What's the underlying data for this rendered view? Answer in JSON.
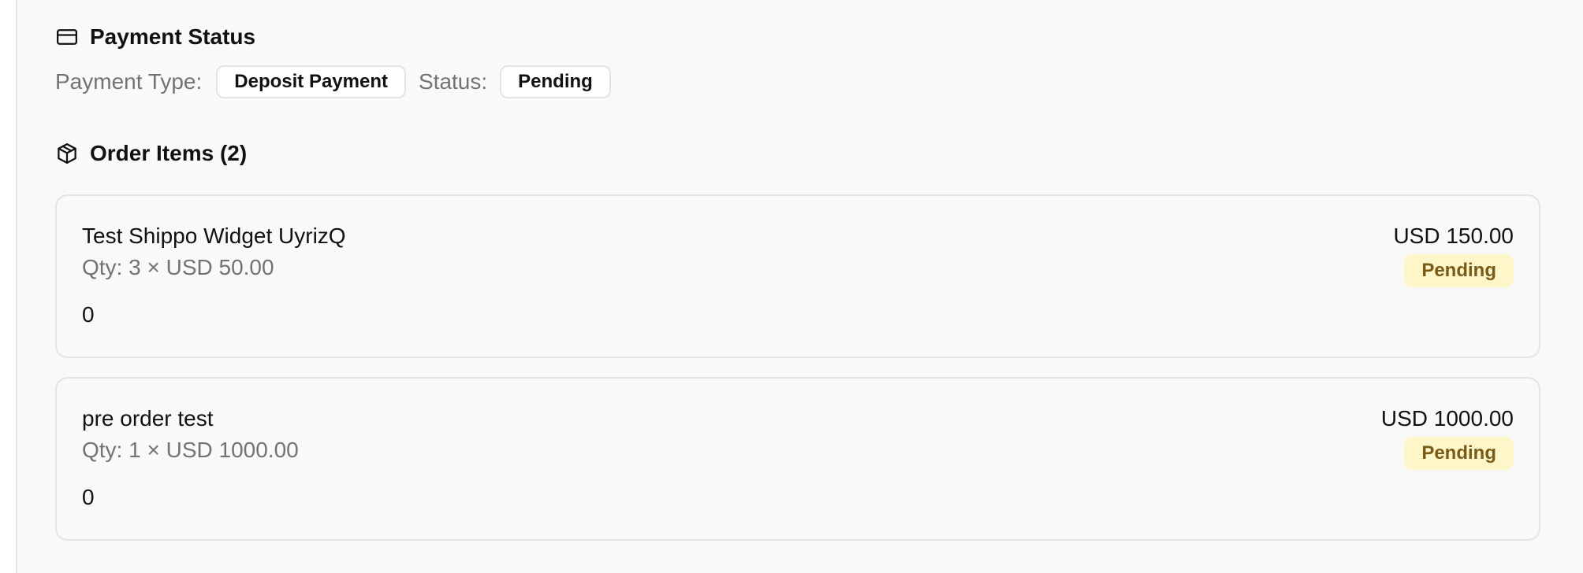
{
  "payment": {
    "title": "Payment Status",
    "icon": "credit-card-icon",
    "type_label": "Payment Type:",
    "type_value": "Deposit Payment",
    "status_label": "Status:",
    "status_value": "Pending"
  },
  "order_items": {
    "title": "Order Items (2)",
    "icon": "package-icon",
    "items": [
      {
        "name": "Test Shippo Widget UyrizQ",
        "qty_line": "Qty: 3 × USD 50.00",
        "extra": "0",
        "total": "USD 150.00",
        "status": "Pending"
      },
      {
        "name": "pre order test",
        "qty_line": "Qty: 1 × USD 1000.00",
        "extra": "0",
        "total": "USD 1000.00",
        "status": "Pending"
      }
    ]
  },
  "colors": {
    "panel_bg": "#f9f9f9",
    "border": "#e4e4e4",
    "muted_text": "#737373",
    "pending_badge_bg": "#fcf6c8",
    "pending_badge_text": "#7a5a17"
  }
}
